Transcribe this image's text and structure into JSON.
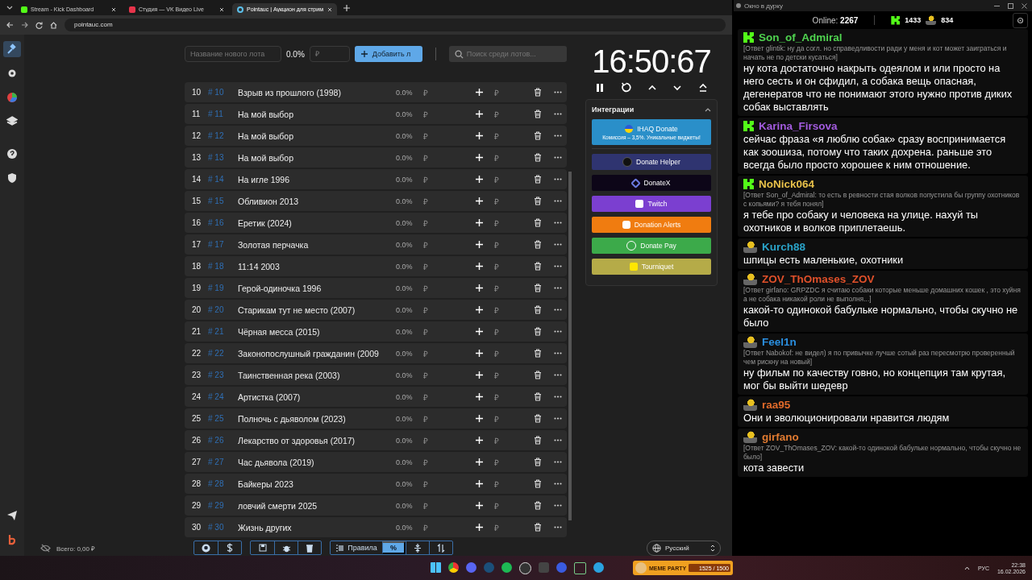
{
  "browser": {
    "tabs": [
      {
        "title": "Stream - Kick Dashboard",
        "kind": "kick",
        "selected": false
      },
      {
        "title": "Студия — VK Видео Live",
        "kind": "vk",
        "selected": false
      },
      {
        "title": "Pointauc | Аукцион для стрим",
        "kind": "pointauc",
        "selected": true
      }
    ],
    "address": "pointauc.com"
  },
  "sidebar": [
    {
      "kind": "gavel",
      "selected": true
    },
    {
      "kind": "gear",
      "selected": false
    },
    {
      "kind": "pie",
      "selected": false
    },
    {
      "kind": "layers",
      "selected": false
    },
    {
      "kind": "help",
      "selected": false
    },
    {
      "kind": "shield",
      "selected": false
    }
  ],
  "toolbar": {
    "name_placeholder": "Название нового лота",
    "percent": "0.0%",
    "amount_placeholder": "₽",
    "add_button": "Добавить л",
    "search_placeholder": "Поиск среди лотов..."
  },
  "lots": [
    {
      "index": "10",
      "id": "# 10",
      "name": "Взрыв из прошлого (1998)",
      "percent": "0.0%",
      "amount": "₽",
      "add_amount": "₽"
    },
    {
      "index": "11",
      "id": "# 11",
      "name": "На мой выбор",
      "percent": "0.0%",
      "amount": "₽",
      "add_amount": "₽"
    },
    {
      "index": "12",
      "id": "# 12",
      "name": "На мой выбор",
      "percent": "0.0%",
      "amount": "₽",
      "add_amount": "₽"
    },
    {
      "index": "13",
      "id": "# 13",
      "name": "На мой выбор",
      "percent": "0.0%",
      "amount": "₽",
      "add_amount": "₽"
    },
    {
      "index": "14",
      "id": "# 14",
      "name": "На игле 1996",
      "percent": "0.0%",
      "amount": "₽",
      "add_amount": "₽"
    },
    {
      "index": "15",
      "id": "# 15",
      "name": "Обливион 2013",
      "percent": "0.0%",
      "amount": "₽",
      "add_amount": "₽"
    },
    {
      "index": "16",
      "id": "# 16",
      "name": "Еретик (2024)",
      "percent": "0.0%",
      "amount": "₽",
      "add_amount": "₽"
    },
    {
      "index": "17",
      "id": "# 17",
      "name": "Золотая перчачка",
      "percent": "0.0%",
      "amount": "₽",
      "add_amount": "₽"
    },
    {
      "index": "18",
      "id": "# 18",
      "name": "11:14 2003",
      "percent": "0.0%",
      "amount": "₽",
      "add_amount": "₽"
    },
    {
      "index": "19",
      "id": "# 19",
      "name": "Герой-одиночка 1996",
      "percent": "0.0%",
      "amount": "₽",
      "add_amount": "₽"
    },
    {
      "index": "20",
      "id": "# 20",
      "name": "Старикам тут не место (2007)",
      "percent": "0.0%",
      "amount": "₽",
      "add_amount": "₽"
    },
    {
      "index": "21",
      "id": "# 21",
      "name": "Чёрная месса (2015)",
      "percent": "0.0%",
      "amount": "₽",
      "add_amount": "₽"
    },
    {
      "index": "22",
      "id": "# 22",
      "name": "Законопослушный гражданин (2009",
      "percent": "0.0%",
      "amount": "₽",
      "add_amount": "₽"
    },
    {
      "index": "23",
      "id": "# 23",
      "name": "Таинственная река (2003)",
      "percent": "0.0%",
      "amount": "₽",
      "add_amount": "₽"
    },
    {
      "index": "24",
      "id": "# 24",
      "name": "Артистка (2007)",
      "percent": "0.0%",
      "amount": "₽",
      "add_amount": "₽"
    },
    {
      "index": "25",
      "id": "# 25",
      "name": "Полночь с дьяволом (2023)",
      "percent": "0.0%",
      "amount": "₽",
      "add_amount": "₽"
    },
    {
      "index": "26",
      "id": "# 26",
      "name": "Лекарство от здоровья (2017)",
      "percent": "0.0%",
      "amount": "₽",
      "add_amount": "₽"
    },
    {
      "index": "27",
      "id": "# 27",
      "name": "Час дьявола (2019)",
      "percent": "0.0%",
      "amount": "₽",
      "add_amount": "₽"
    },
    {
      "index": "28",
      "id": "# 28",
      "name": "Байкеры 2023",
      "percent": "0.0%",
      "amount": "₽",
      "add_amount": "₽"
    },
    {
      "index": "29",
      "id": "# 29",
      "name": "ловчий смерти 2025",
      "percent": "0.0%",
      "amount": "₽",
      "add_amount": "₽"
    },
    {
      "index": "30",
      "id": "# 30",
      "name": "Жизнь других",
      "percent": "0.0%",
      "amount": "₽",
      "add_amount": "₽"
    }
  ],
  "timer": "16:50:67",
  "integrations": {
    "title": "Интеграции",
    "expanded": true,
    "items": [
      {
        "label": "IHAQ Donate",
        "subtitle": "Комиссия – 3,5%. Уникальные виджеты!",
        "color": "#2a8fc9",
        "kind": "ihaq"
      },
      {
        "label": "Donate Helper",
        "color": "#2f3470",
        "kind": "dh"
      },
      {
        "label": "DonateX",
        "color": "#0d0618",
        "kind": "x"
      },
      {
        "label": "Twitch",
        "color": "#7b3fd0",
        "kind": "twitch"
      },
      {
        "label": "Donation Alerts",
        "color": "#f07c10",
        "kind": "da"
      },
      {
        "label": "Donate Pay",
        "color": "#3caa4a",
        "kind": "dp"
      },
      {
        "label": "Tourniquet",
        "color": "#b5ab48",
        "kind": "tq"
      }
    ]
  },
  "footer": {
    "total": "Всего: 0,00 ₽",
    "rules": "Правила",
    "percent": "%",
    "percent_selected": true,
    "language": "Русский"
  },
  "chat": {
    "title": "Окно в дурку",
    "online_label": "Online:",
    "online": "2267",
    "kick_count": "1433",
    "vk_count": "834",
    "messages": [
      {
        "kind": "kick",
        "user": "Son_of_Admiral",
        "color": "#4fd34f",
        "reply": "[Ответ glintik: ну да согл. но справедливости ради у меня и кот может заиграться и начать не по детски кусаться]",
        "text": "ну кота достаточно накрыть одеялом и или просто на него сесть и он сфидил, а собака вещь опасная, дегенератов что не понимают этого нужно против диких собак выставлять"
      },
      {
        "kind": "kick",
        "user": "Karina_Firsova",
        "color": "#a45ce0",
        "text": "сейчас фраза «я люблю собак» сразу воспринимается как зоошиза, потому что таких дохрена. раньше это всегда было просто хорошее к ним отношение."
      },
      {
        "kind": "kick",
        "user": "NoNick064",
        "color": "#e8c14a",
        "reply": "[Ответ Son_of_Admiral: то есть в ревности стая волков попустила бы группу охотников с копьями? я тебя понял]",
        "text": "я тебе про собаку и человека на улице. нахуй ты охотников и волков приплетаешь."
      },
      {
        "kind": "vk",
        "user": "Kurch88",
        "color": "#2aa3c8",
        "text": "шпицы есть маленькие, охотники"
      },
      {
        "kind": "vk",
        "user": "ZOV_ThOmases_ZOV",
        "color": "#e0502a",
        "reply": "[Ответ girfano: GRPZDC я считаю собаки которые меньше домашних кошек , это хуйня а не собака никакой роли не выполня...]",
        "text": "какой-то одинокой бабульке нормально, чтобы скучно не было"
      },
      {
        "kind": "vk",
        "user": "Feel1n",
        "color": "#2a8fe0",
        "reply": "[Ответ Nabokof: не видел) я по привычке лучше сотый раз пересмотрю проверенный чем рискну на новый]",
        "text": "ну фильм по качеству говно, но концепция там крутая, мог бы выйти шедевр"
      },
      {
        "kind": "vk",
        "user": "raa95",
        "color": "#e06a2a",
        "text": "Они и эволюционировали нравится людям"
      },
      {
        "kind": "vk",
        "user": "girfano",
        "color": "#e07a30",
        "reply": "[Ответ ZOV_ThOmases_ZOV: какой-то одинокой бабульке нормально, чтобы скучно не было]",
        "text": "кота завести"
      }
    ]
  },
  "taskbar": {
    "meme": {
      "title": "MEME PARTY",
      "progress": "1525 / 1500",
      "level": 1
    },
    "language": "РУС",
    "time": "22:38",
    "date": "16.02.2026"
  }
}
